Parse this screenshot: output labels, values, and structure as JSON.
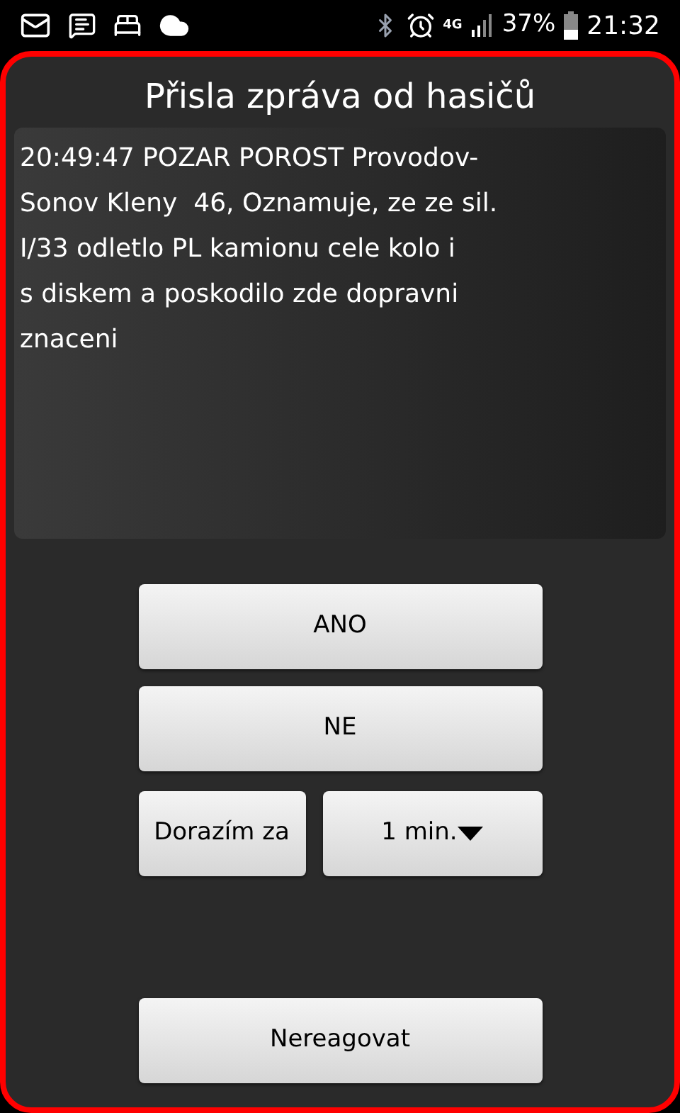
{
  "status_bar": {
    "network": "4G",
    "battery": "37%",
    "time": "21:32"
  },
  "dialog": {
    "title": "Přisla zpráva od hasičů",
    "message": "20:49:47 POZAR POROST Provodov-\nSonov Kleny  46, Oznamuje, ze ze sil.\nI/33 odletlo PL kamionu cele kolo i\ns diskem a poskodilo zde dopravni\nznaceni",
    "buttons": [
      "ANO",
      "NE"
    ],
    "arrival_label": "Dorazím za",
    "arrival_select": {
      "value": "1 min."
    },
    "ignore_button": "Nereagovat"
  }
}
